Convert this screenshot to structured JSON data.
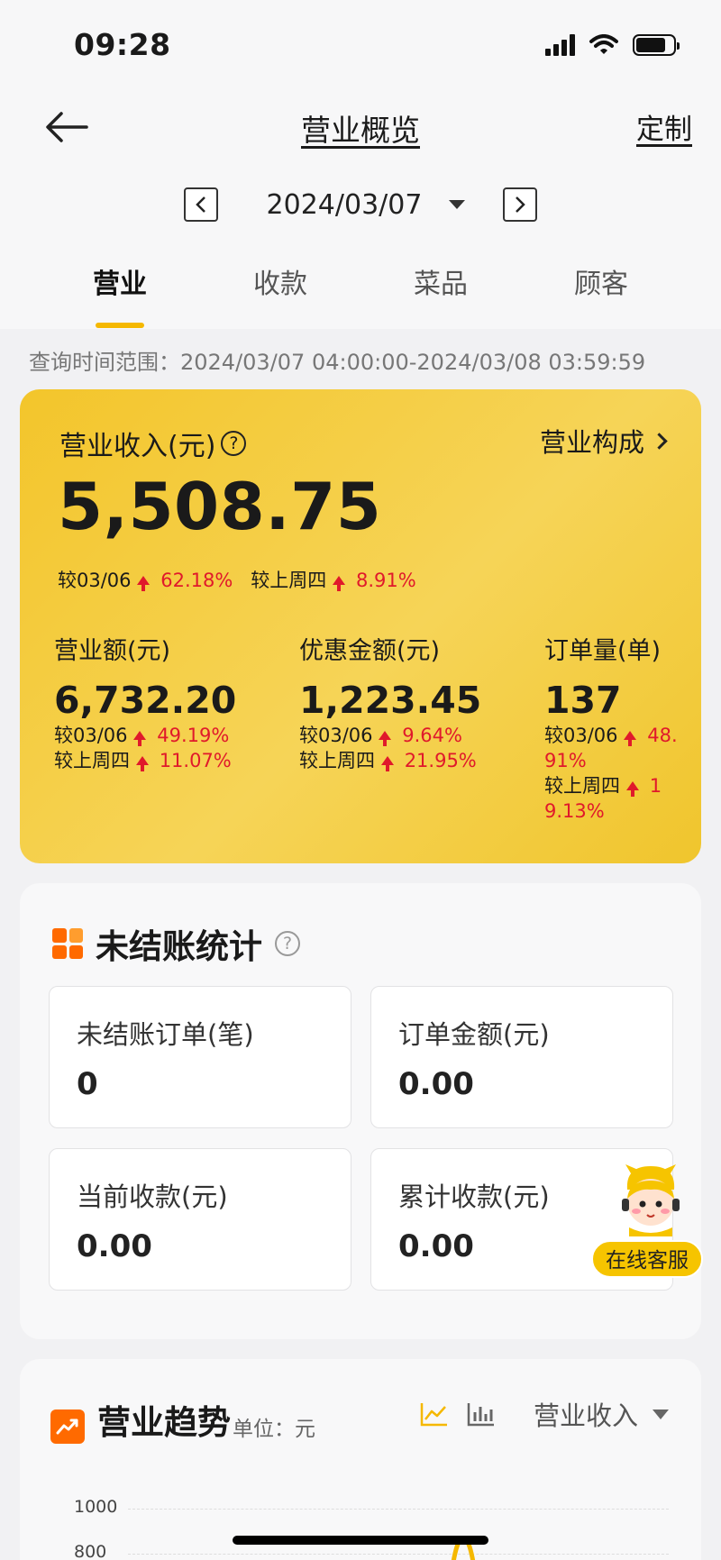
{
  "status": {
    "time": "09:28"
  },
  "nav": {
    "title": "营业概览",
    "custom": "定制"
  },
  "date": {
    "current": "2024/03/07"
  },
  "tabs": [
    {
      "label": "营业",
      "active": true
    },
    {
      "label": "收款",
      "active": false
    },
    {
      "label": "菜品",
      "active": false
    },
    {
      "label": "顾客",
      "active": false
    }
  ],
  "query_range": "查询时间范围：2024/03/07 04:00:00-2024/03/08 03:59:59",
  "revenue": {
    "label": "营业收入(元)",
    "help": "?",
    "compose": "营业构成",
    "value": "5,508.75",
    "compare_day_label": "较03/06",
    "compare_day_value": "62.18%",
    "compare_week_label": "较上周四",
    "compare_week_value": "8.91%"
  },
  "metrics": [
    {
      "label": "营业额(元)",
      "value": "6,732.20",
      "day_label": "较03/06",
      "day_value": "49.19%",
      "week_label": "较上周四",
      "week_value": "11.07%"
    },
    {
      "label": "优惠金额(元)",
      "value": "1,223.45",
      "day_label": "较03/06",
      "day_value": "9.64%",
      "week_label": "较上周四",
      "week_value": "21.95%"
    },
    {
      "label": "订单量(单)",
      "value": "137",
      "day_label": "较03/06",
      "day_value": "48.91%",
      "week_label": "较上周四",
      "week_value": "19.13%"
    }
  ],
  "unsettled": {
    "title": "未结账统计",
    "help": "?",
    "boxes": [
      {
        "label": "未结账订单(笔)",
        "value": "0"
      },
      {
        "label": "订单金额(元)",
        "value": "0.00"
      },
      {
        "label": "当前收款(元)",
        "value": "0.00"
      },
      {
        "label": "累计收款(元)",
        "value": "0.00"
      }
    ]
  },
  "service": {
    "label": "在线客服"
  },
  "trend": {
    "title": "营业趋势",
    "unit": "单位：元",
    "select": "营业收入",
    "yticks": [
      "1000",
      "800"
    ]
  },
  "colors": {
    "accent": "#f5b800",
    "up": "#e0192b",
    "icon": "#ff6a00"
  }
}
